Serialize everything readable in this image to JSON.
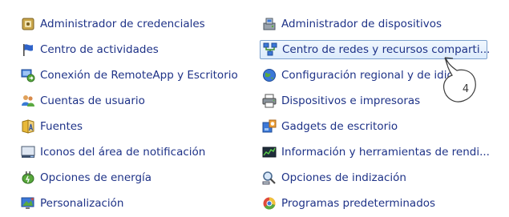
{
  "left_items": [
    {
      "label": "Administrador de credenciales",
      "icon": "credential-manager-icon"
    },
    {
      "label": "Centro de actividades",
      "icon": "flag-icon"
    },
    {
      "label": "Conexión de RemoteApp y Escritorio",
      "icon": "remote-desktop-icon"
    },
    {
      "label": "Cuentas de usuario",
      "icon": "users-icon"
    },
    {
      "label": "Fuentes",
      "icon": "fonts-icon"
    },
    {
      "label": "Iconos del área de notificación",
      "icon": "notification-area-icon"
    },
    {
      "label": "Opciones de energía",
      "icon": "power-options-icon"
    },
    {
      "label": "Personalización",
      "icon": "personalization-icon"
    }
  ],
  "right_items": [
    {
      "label": "Administrador de dispositivos",
      "icon": "device-manager-icon"
    },
    {
      "label": "Centro de redes y recursos comparti...",
      "icon": "network-center-icon",
      "highlighted": true
    },
    {
      "label": "Configuración regional y de idioma",
      "icon": "region-language-icon"
    },
    {
      "label": "Dispositivos e impresoras",
      "icon": "printer-icon"
    },
    {
      "label": "Gadgets de escritorio",
      "icon": "gadgets-icon"
    },
    {
      "label": "Información y herramientas de rendi...",
      "icon": "performance-icon"
    },
    {
      "label": "Opciones de indización",
      "icon": "indexing-icon"
    },
    {
      "label": "Programas predeterminados",
      "icon": "default-programs-icon"
    }
  ],
  "callout": {
    "number": "4"
  },
  "colors": {
    "link": "#1e3287",
    "highlight_border": "#7da2ce"
  }
}
